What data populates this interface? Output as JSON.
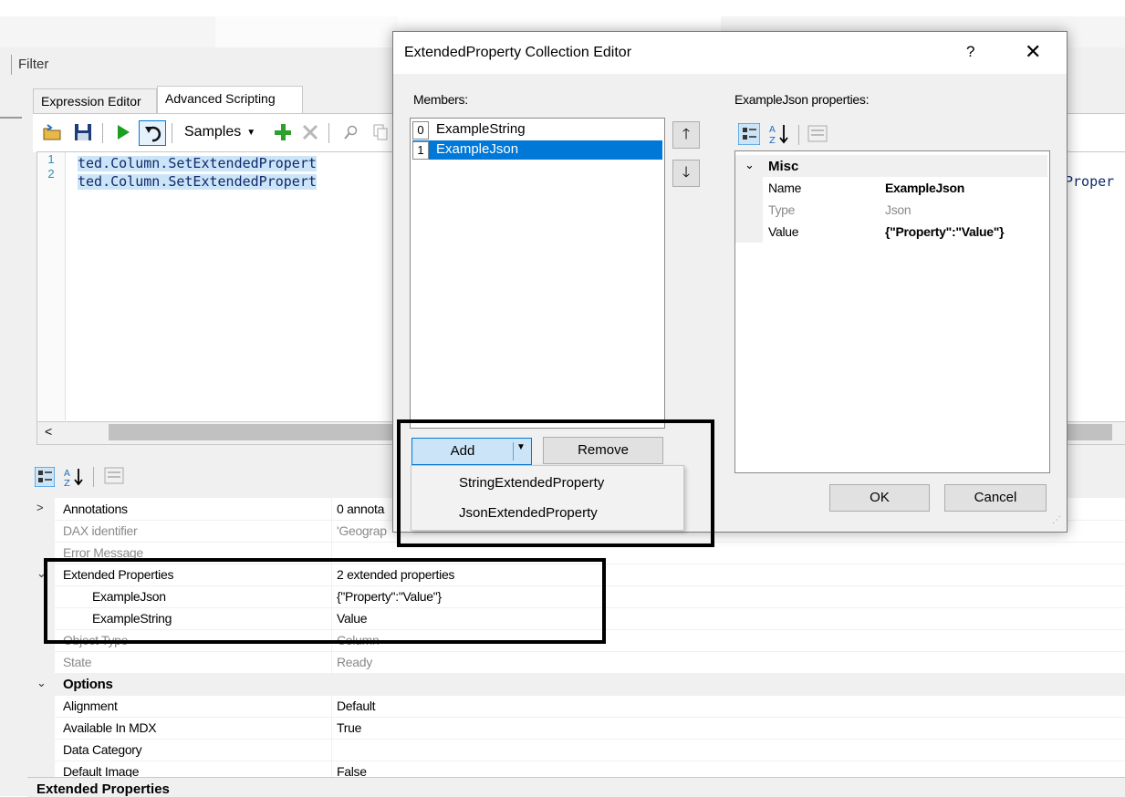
{
  "app": {
    "filter_label": "Filter",
    "tabs": [
      {
        "label": "Expression Editor"
      },
      {
        "label": "Advanced Scripting"
      }
    ],
    "toolbar": {
      "samples_label": "Samples",
      "icons": [
        "open-icon",
        "save-icon",
        "run-icon",
        "undo-icon",
        "add-icon",
        "delete-icon",
        "search-icon",
        "copy-icon"
      ]
    },
    "code": {
      "line_numbers": [
        "1",
        "2"
      ],
      "lines": [
        "ted.Column.SetExtendedPropert",
        "ted.Column.SetExtendedPropert"
      ],
      "right_overflow": "Proper"
    },
    "properties": {
      "rows": [
        {
          "name": "Annotations",
          "value": "0 annota"
        },
        {
          "name": "DAX identifier",
          "value": "'Geograp"
        },
        {
          "name": "Error Message",
          "value": ""
        },
        {
          "name": "Extended Properties",
          "value": "2 extended properties"
        },
        {
          "name": "ExampleJson",
          "value": "{\"Property\":\"Value\"}"
        },
        {
          "name": "ExampleString",
          "value": "Value"
        },
        {
          "name": "Object Type",
          "value": "Column"
        },
        {
          "name": "State",
          "value": "Ready"
        },
        {
          "name": "Options",
          "value": ""
        },
        {
          "name": "Alignment",
          "value": "Default"
        },
        {
          "name": "Available In MDX",
          "value": "True"
        },
        {
          "name": "Data Category",
          "value": ""
        },
        {
          "name": "Default Image",
          "value": "False"
        }
      ],
      "description_title": "Extended Properties"
    }
  },
  "dialog": {
    "title": "ExtendedProperty Collection Editor",
    "help_glyph": "?",
    "close_glyph": "✕",
    "members_label": "Members:",
    "members": [
      {
        "index": "0",
        "name": "ExampleString"
      },
      {
        "index": "1",
        "name": "ExampleJson"
      }
    ],
    "properties_label": "ExampleJson properties:",
    "category": "Misc",
    "props": [
      {
        "name": "Name",
        "value": "ExampleJson"
      },
      {
        "name": "Type",
        "value": "Json"
      },
      {
        "name": "Value",
        "value": "{\"Property\":\"Value\"}"
      }
    ],
    "add_label": "Add",
    "remove_label": "Remove",
    "ok_label": "OK",
    "cancel_label": "Cancel",
    "add_menu": [
      "StringExtendedProperty",
      "JsonExtendedProperty"
    ]
  }
}
